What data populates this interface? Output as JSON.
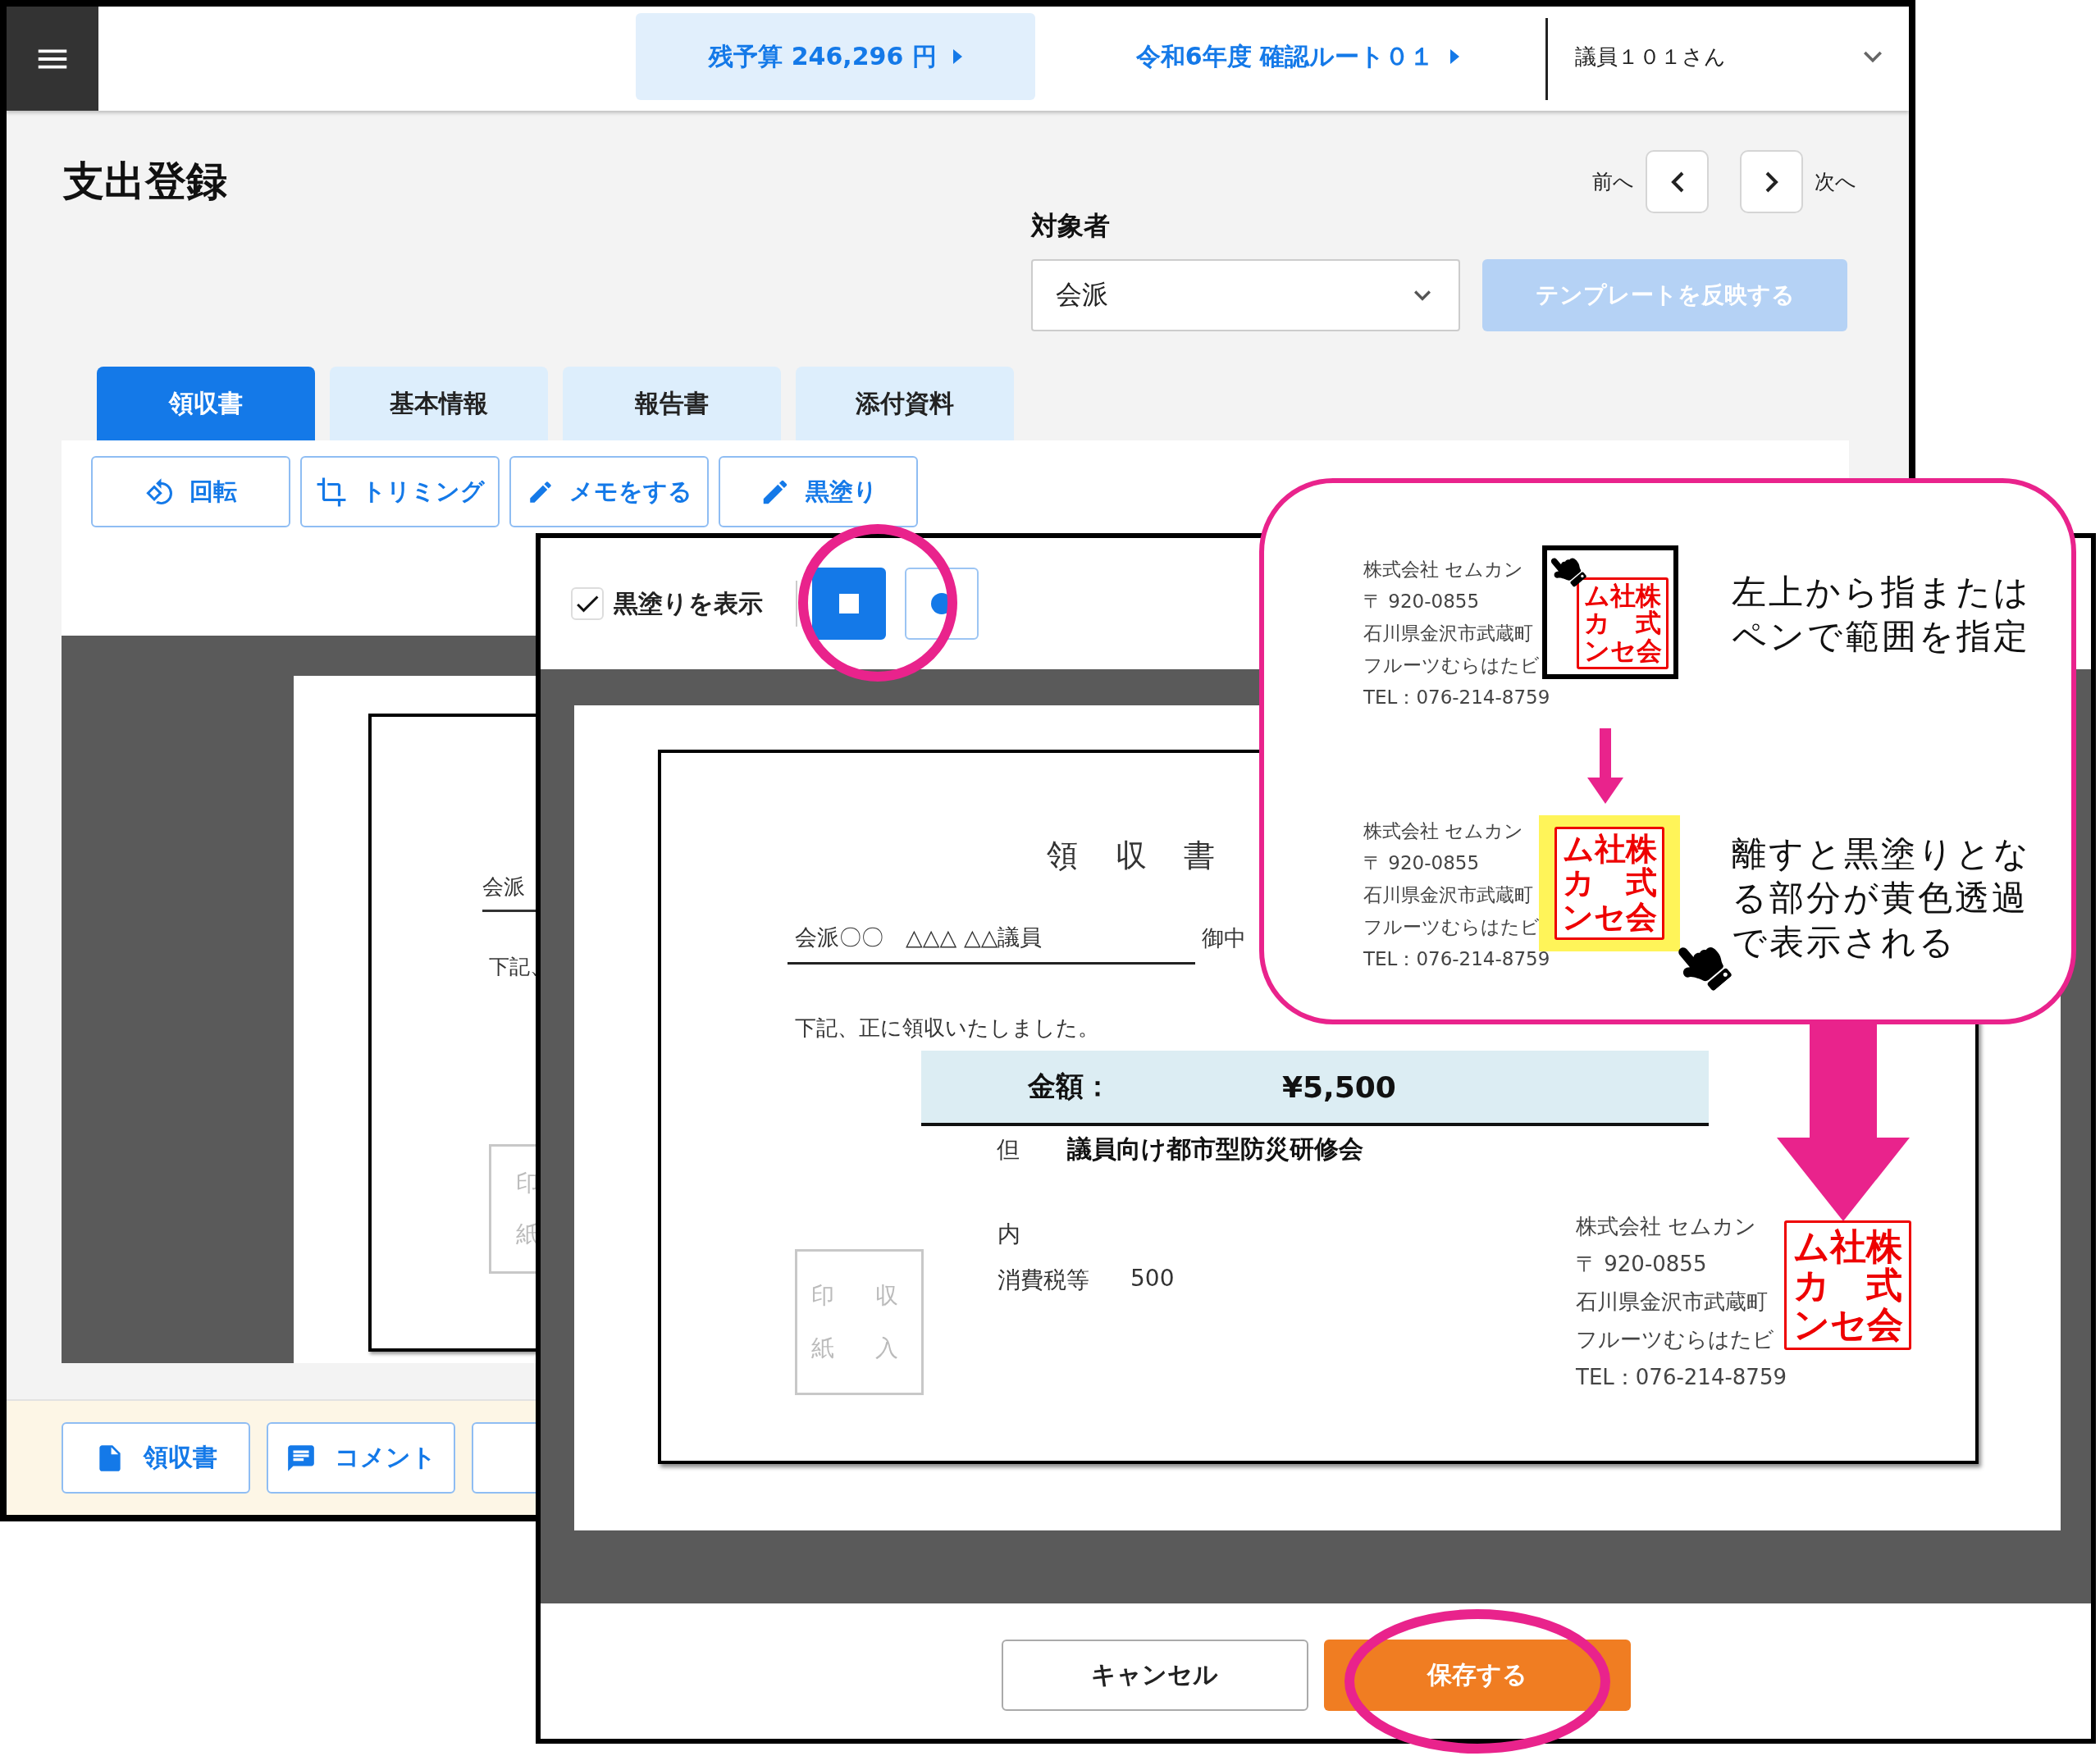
{
  "header": {
    "budget": "残予算 246,296 円",
    "route": "令和6年度 確認ルート０１",
    "user": "議員１０１さん"
  },
  "page": {
    "title": "支出登録",
    "prev": "前へ",
    "next": "次へ"
  },
  "target": {
    "label": "対象者",
    "value": "会派",
    "template_button": {
      "label": "テンプレートを反映する",
      "disabled": true
    }
  },
  "tabs": [
    {
      "label": "領収書",
      "selected": true
    },
    {
      "label": "基本情報",
      "selected": false
    },
    {
      "label": "報告書",
      "selected": false
    },
    {
      "label": "添付資料",
      "selected": false
    }
  ],
  "tools": [
    {
      "kind": "rotate",
      "label": "回転"
    },
    {
      "kind": "crop",
      "label": "トリミング"
    },
    {
      "kind": "memo",
      "label": "メモをする"
    },
    {
      "kind": "redact",
      "label": "黒塗り"
    }
  ],
  "preview_fragments": {
    "addressee": "会派",
    "statement": "下記、",
    "stamp": [
      "印",
      "紙"
    ]
  },
  "bottom_actions": [
    {
      "kind": "file",
      "label": "領収書"
    },
    {
      "kind": "comment",
      "label": "コメント"
    },
    {
      "kind": "edit"
    }
  ],
  "dialog": {
    "show_redaction": {
      "label": "黒塗りを表示",
      "checked": true
    },
    "shapes": [
      {
        "kind": "rect",
        "selected": true
      },
      {
        "kind": "circle",
        "selected": false
      }
    ],
    "receipt": {
      "title": "領　収　書",
      "addressee": "会派〇〇　△△△ △△議員",
      "honorific": "御中",
      "statement": "下記、正に領収いたしました。",
      "amount_label": "金額：",
      "amount": "¥5,500",
      "note_label": "但",
      "note": "議員向け都市型防災研修会",
      "breakdown_label": "内",
      "tax_label": "消費税等",
      "tax": "500",
      "stamp": [
        "印　収",
        "紙　入"
      ],
      "issuer": [
        "株式会社 セムカン",
        "〒 920-0855",
        "石川県金沢市武蔵町",
        "フルーツむらはたビ",
        "TEL：076-214-8759"
      ],
      "seal": [
        "ム社株",
        "カ　式",
        "ンセ会"
      ]
    },
    "cancel": "キャンセル",
    "save": "保存する"
  },
  "callout": {
    "steps": [
      {
        "kind": "drag",
        "text": "左上から指またはペンで範囲を指定",
        "issuer": [
          "株式会社 セムカン",
          "〒 920-0855",
          "石川県金沢市武蔵町",
          "フルーツむらはたビ",
          "TEL：076-214-8759"
        ],
        "seal": [
          "ム社株",
          "カ　式",
          "ンセ会"
        ]
      },
      {
        "kind": "release",
        "text": "離すと黒塗りとなる部分が黄色透過で表示される",
        "issuer": [
          "株式会社 セムカン",
          "〒 920-0855",
          "石川県金沢市武蔵町",
          "フルーツむらはたビ",
          "TEL：076-214-8759"
        ],
        "seal": [
          "ム社株",
          "カ　式",
          "ンセ会"
        ]
      }
    ]
  }
}
